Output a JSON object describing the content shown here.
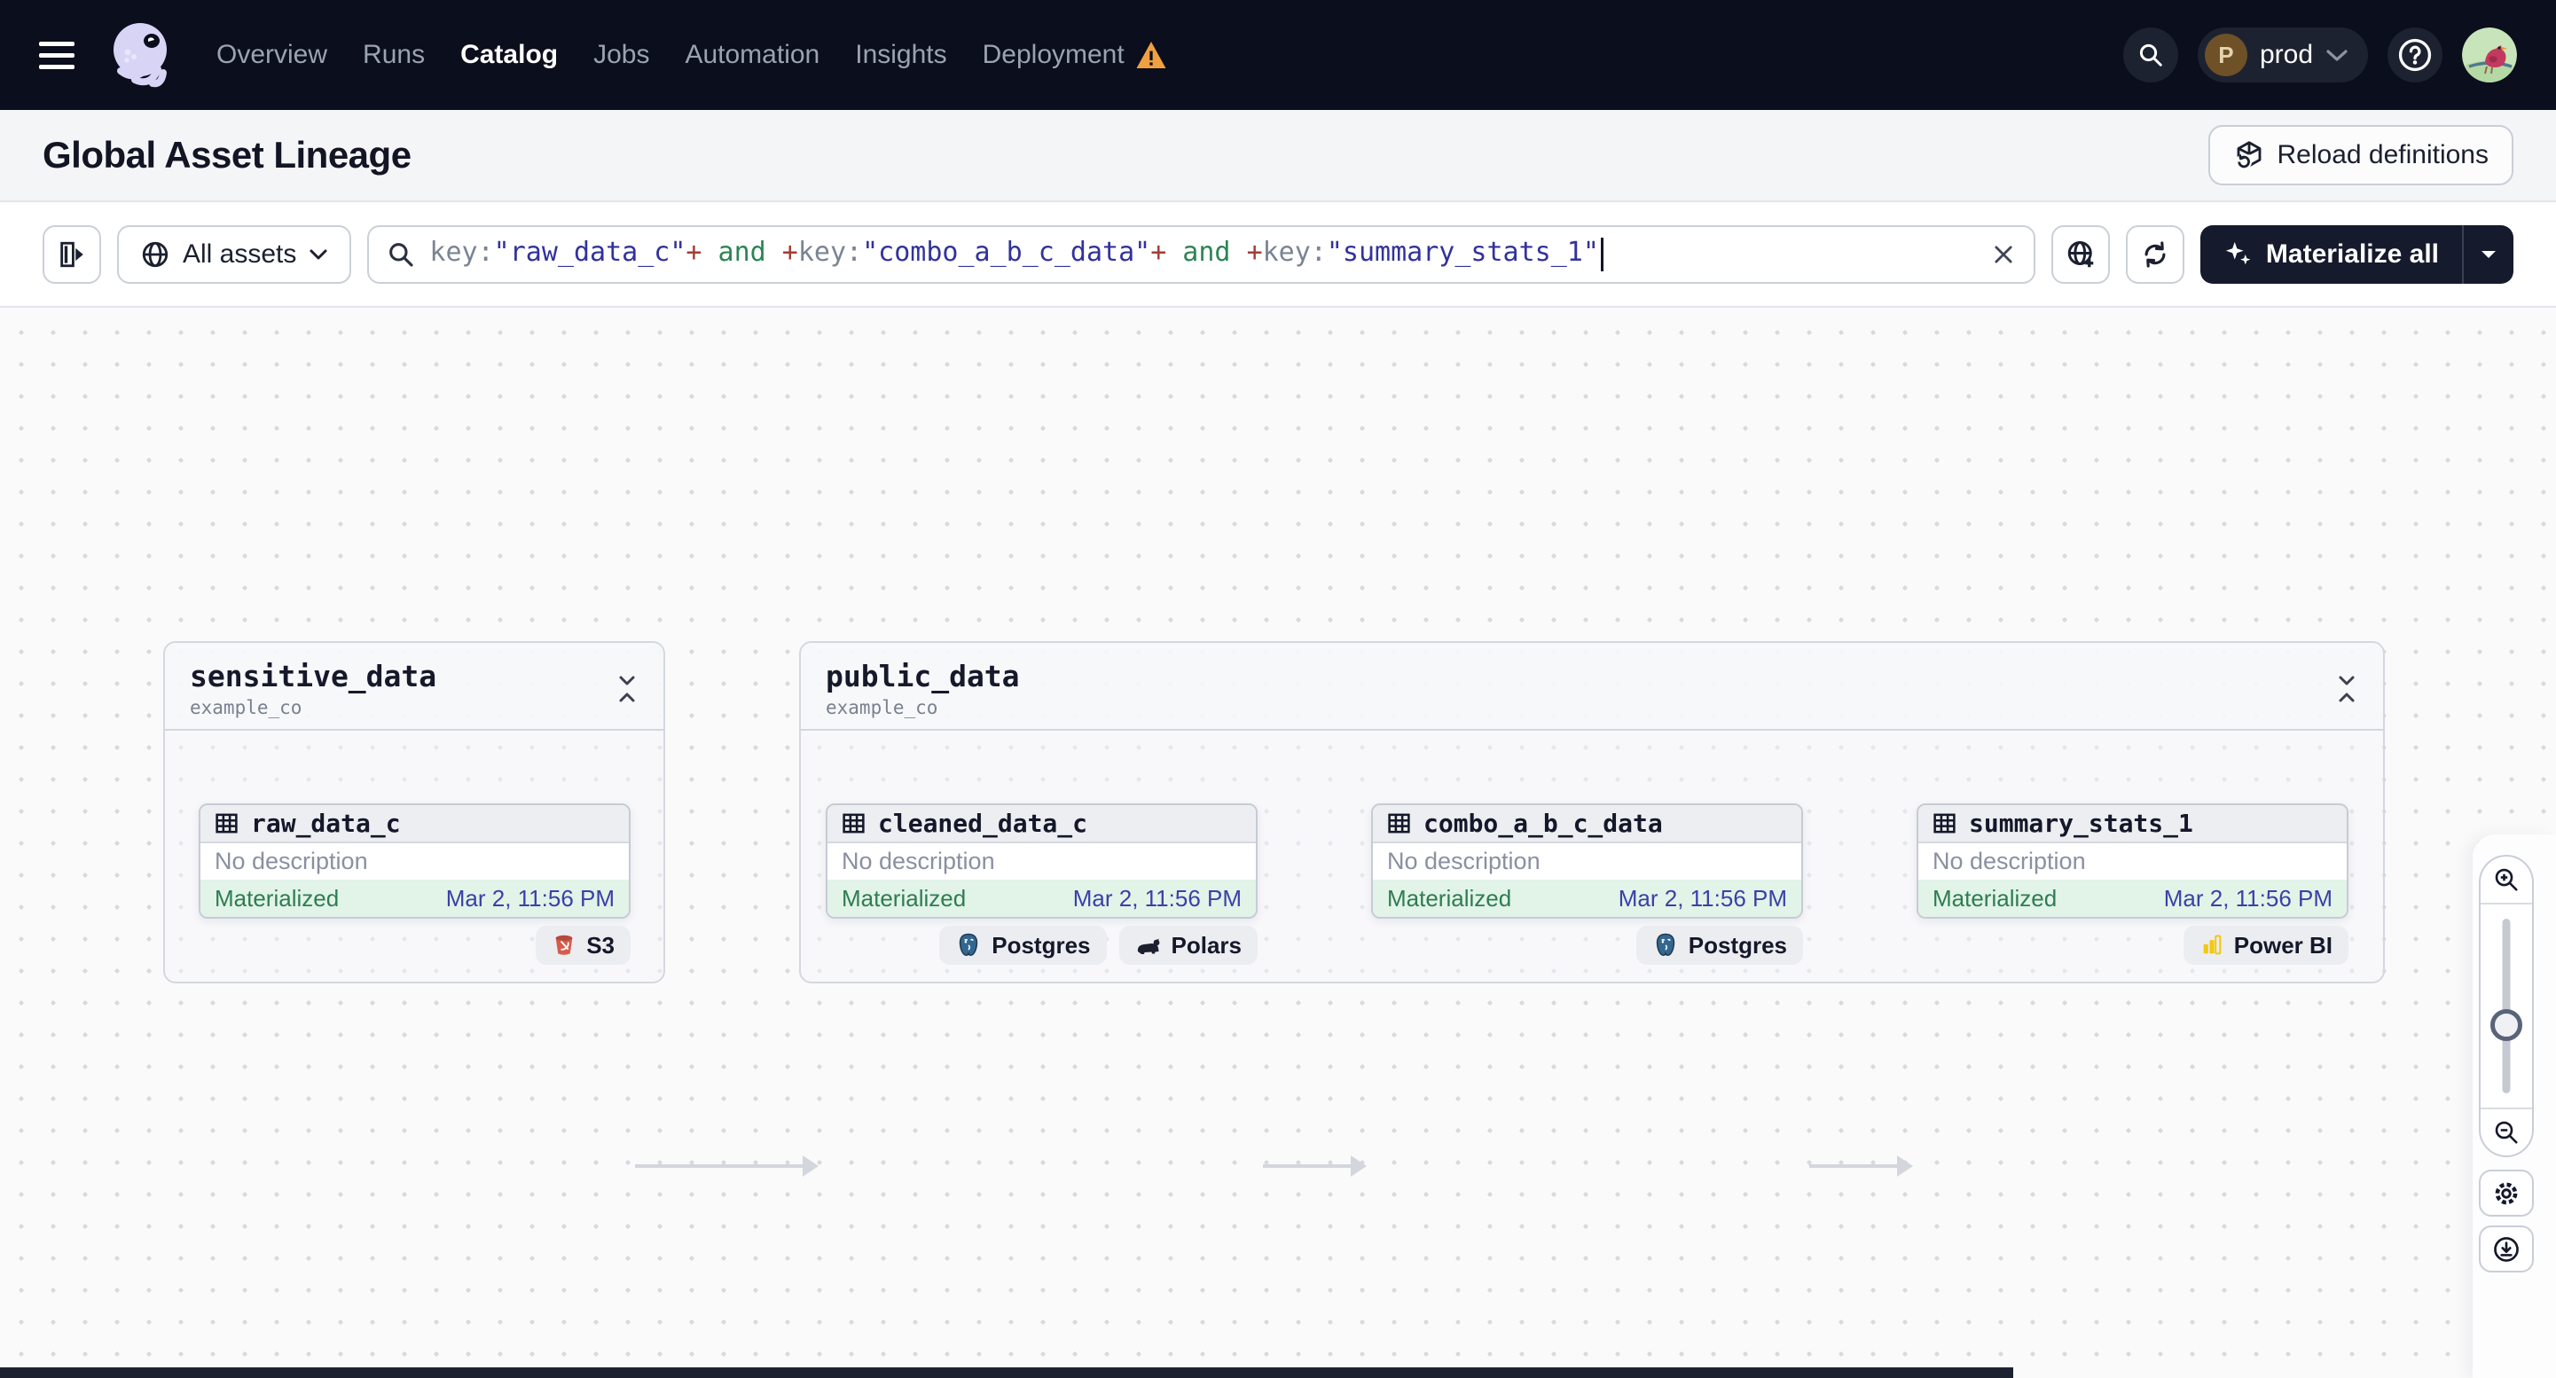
{
  "nav": {
    "items": [
      {
        "label": "Overview",
        "active": false,
        "warning": false
      },
      {
        "label": "Runs",
        "active": false,
        "warning": false
      },
      {
        "label": "Catalog",
        "active": true,
        "warning": false
      },
      {
        "label": "Jobs",
        "active": false,
        "warning": false
      },
      {
        "label": "Automation",
        "active": false,
        "warning": false
      },
      {
        "label": "Insights",
        "active": false,
        "warning": false
      },
      {
        "label": "Deployment",
        "active": false,
        "warning": true
      }
    ],
    "environment": {
      "initial": "P",
      "name": "prod"
    }
  },
  "header": {
    "title": "Global Asset Lineage",
    "reload_button_label": "Reload definitions"
  },
  "toolbar": {
    "scope_filter_label": "All assets",
    "materialize_button_label": "Materialize all",
    "search": {
      "full_query": "key:\"raw_data_c\"+ and +key:\"combo_a_b_c_data\"+ and +key:\"summary_stats_1\"",
      "tokens": [
        {
          "text": "key:",
          "type": "key"
        },
        {
          "text": "\"raw_data_c\"",
          "type": "string"
        },
        {
          "text": "+",
          "type": "plus"
        },
        {
          "text": " and ",
          "type": "and"
        },
        {
          "text": "+",
          "type": "plus"
        },
        {
          "text": "key:",
          "type": "key"
        },
        {
          "text": "\"combo_a_b_c_data\"",
          "type": "string"
        },
        {
          "text": "+",
          "type": "plus"
        },
        {
          "text": " and ",
          "type": "and"
        },
        {
          "text": "+",
          "type": "plus"
        },
        {
          "text": "key:",
          "type": "key"
        },
        {
          "text": "\"summary_stats_1\"",
          "type": "string"
        }
      ]
    }
  },
  "graph": {
    "groups": [
      {
        "name": "sensitive_data",
        "location": "example_co"
      },
      {
        "name": "public_data",
        "location": "example_co"
      }
    ],
    "nodes": [
      {
        "name": "raw_data_c",
        "group": "sensitive_data",
        "description": "No description",
        "status": "Materialized",
        "timestamp": "Mar 2, 11:56 PM",
        "badges": [
          {
            "label": "S3",
            "icon": "s3-bucket-icon"
          }
        ]
      },
      {
        "name": "cleaned_data_c",
        "group": "public_data",
        "description": "No description",
        "status": "Materialized",
        "timestamp": "Mar 2, 11:56 PM",
        "badges": [
          {
            "label": "Postgres",
            "icon": "postgres-icon"
          },
          {
            "label": "Polars",
            "icon": "polars-icon"
          }
        ]
      },
      {
        "name": "combo_a_b_c_data",
        "group": "public_data",
        "description": "No description",
        "status": "Materialized",
        "timestamp": "Mar 2, 11:56 PM",
        "badges": [
          {
            "label": "Postgres",
            "icon": "postgres-icon"
          }
        ]
      },
      {
        "name": "summary_stats_1",
        "group": "public_data",
        "description": "No description",
        "status": "Materialized",
        "timestamp": "Mar 2, 11:56 PM",
        "badges": [
          {
            "label": "Power BI",
            "icon": "power-bi-icon"
          }
        ]
      }
    ],
    "edges": [
      {
        "from": "raw_data_c",
        "to": "cleaned_data_c"
      },
      {
        "from": "cleaned_data_c",
        "to": "combo_a_b_c_data"
      },
      {
        "from": "combo_a_b_c_data",
        "to": "summary_stats_1"
      }
    ]
  },
  "colors": {
    "navbar_bg": "#0B0E1C",
    "accent_dark_button": "#151A2C",
    "status_materialized_green": "#2E7D50",
    "status_bg_green": "#E2F3E8",
    "timestamp_blue": "#3A41A8",
    "query_string_blue": "#32329D",
    "query_operator_red": "#A33D33",
    "query_and_green": "#2E8456",
    "warning_orange": "#F0A13F",
    "brand_lavender": "#D8D4F6",
    "s3_red": "#D75C4B",
    "postgres_blue": "#336791",
    "powerbi_yellow": "#F2C811"
  }
}
